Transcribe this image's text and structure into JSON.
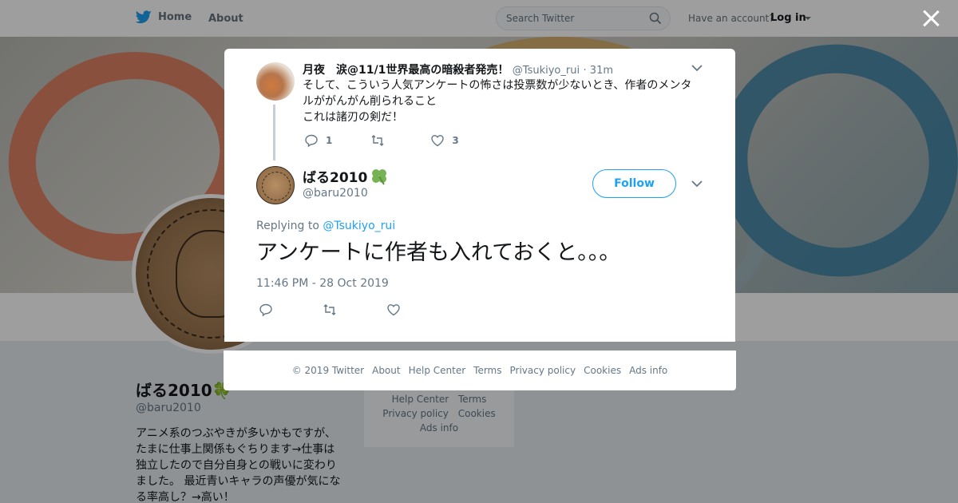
{
  "nav": {
    "home_label": "Home",
    "about_label": "About",
    "search_placeholder": "Search Twitter",
    "have_account": "Have an account?",
    "login_label": "Log in"
  },
  "profile": {
    "name": "ばる2010",
    "handle": "@baru2010",
    "bio": "アニメ系のつぶやきが多いかもですが、たまに仕事上関係もぐちります→仕事は独立したので自分自身との戦いに変わりました。 最近青いキャラの声優が気になる率高し？→高い！"
  },
  "side_footer": {
    "row1": [
      "Help Center",
      "Terms"
    ],
    "row2": [
      "Privacy policy",
      "Cookies"
    ],
    "row3": [
      "Ads info"
    ]
  },
  "parent_tweet": {
    "name": "月夜　涙@11/1世界最高の暗殺者発売！",
    "handle": "@Tsukiyo_rui",
    "time": "· 31m",
    "text_line1": "そして、こういう人気アンケートの怖さは投票数が少ないとき、作者のメンタ",
    "text_line2": "ルががんがん削られること",
    "text_line3": "これは諸刃の剣だ！",
    "replies": "1",
    "retweets": "",
    "likes": "3"
  },
  "main_tweet": {
    "name": "ばる2010",
    "handle": "@baru2010",
    "follow_label": "Follow",
    "replying_prefix": "Replying to",
    "replying_to": "@Tsukiyo_rui",
    "text": "アンケートに作者も入れておくと。。。",
    "timestamp": "11:46 PM - 28 Oct 2019"
  },
  "modal_footer": [
    "© 2019 Twitter",
    "About",
    "Help Center",
    "Terms",
    "Privacy policy",
    "Cookies",
    "Ads info"
  ],
  "colors": {
    "twitter_blue": "#1da1f2",
    "secondary_text": "#657786"
  }
}
